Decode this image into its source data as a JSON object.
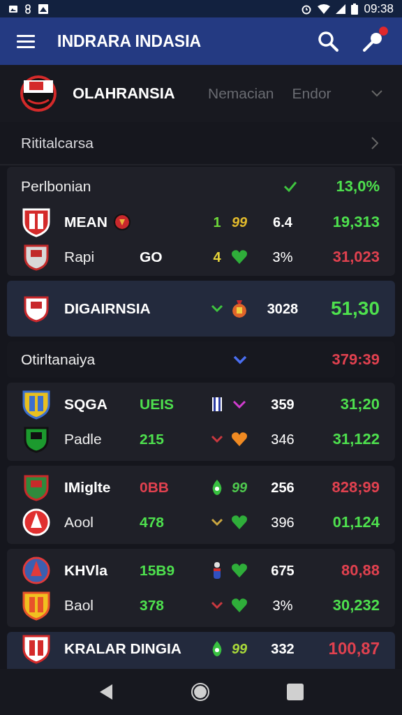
{
  "status_bar": {
    "time": "09:38"
  },
  "app_bar": {
    "title": "INDRARA INDASIA",
    "notification": true
  },
  "league": {
    "name": "OLAHRANSIA",
    "tabs": [
      {
        "label": "Nemacian",
        "selected": false
      },
      {
        "label": "Endor",
        "selected": false
      }
    ]
  },
  "section": {
    "title": "Rititalcarsa"
  },
  "cards": [
    {
      "kind": "group",
      "header": {
        "title": "Perlbonian",
        "marker": {
          "kind": "check",
          "color": "#3fc43f"
        },
        "total": {
          "text": "13,0%",
          "color": "#4ee04e"
        }
      },
      "rows": [
        {
          "name": "MEAN",
          "badge": {
            "kind": "ball"
          },
          "mark": {
            "kind": "score",
            "text": "1",
            "color": "#6ed83a"
          },
          "marker": {
            "kind": "text",
            "text": "99",
            "color": "#e0b92c"
          },
          "value": "6.4",
          "total": {
            "text": "19,313",
            "color": "#4ee04e"
          }
        },
        {
          "name": "Rapi",
          "code": {
            "text": "GO",
            "color": "#ffffff"
          },
          "mark": {
            "kind": "score",
            "text": "4",
            "color": "#e6d43a"
          },
          "marker": {
            "kind": "heart",
            "color": "#2fae3a"
          },
          "value": "3%",
          "total": {
            "text": "31,023",
            "color": "#e0414f"
          }
        }
      ]
    },
    {
      "kind": "featured",
      "rows": [
        {
          "name": "DIGAIRNSIA",
          "mark": {
            "kind": "chevron",
            "color": "#3fc43f"
          },
          "marker": {
            "kind": "medal",
            "color": "#e0642a"
          },
          "value": "3028",
          "total": {
            "text": "51,30",
            "color": "#4ee04e"
          }
        }
      ]
    },
    {
      "kind": "section",
      "header": {
        "title": "Otirltanaiya",
        "marker": {
          "kind": "chevron",
          "color": "#4a6ef0"
        },
        "total": {
          "text": "379:39",
          "color": "#e0414f"
        }
      }
    },
    {
      "kind": "group",
      "rows": [
        {
          "name": "SQGA",
          "code": {
            "text": "UEIS",
            "color": "#4ee04e"
          },
          "mark": {
            "kind": "flag"
          },
          "marker": {
            "kind": "chevron",
            "color": "#d13ccf"
          },
          "value": "359",
          "total": {
            "text": "31;20",
            "color": "#4ee04e"
          }
        },
        {
          "name": "Padle",
          "code": {
            "text": "215",
            "color": "#4ee04e"
          },
          "mark": {
            "kind": "chevron",
            "color": "#c8383f"
          },
          "marker": {
            "kind": "heart",
            "color": "#f08a22"
          },
          "value": "346",
          "total": {
            "text": "31,122",
            "color": "#4ee04e"
          }
        }
      ]
    },
    {
      "kind": "group",
      "rows": [
        {
          "name": "IMiglte",
          "code": {
            "text": "0BB",
            "color": "#e0414f"
          },
          "mark": {
            "kind": "leaf"
          },
          "marker": {
            "kind": "text",
            "text": "99",
            "color": "#4ec84e"
          },
          "value": "256",
          "total": {
            "text": "828;99",
            "color": "#e0414f"
          }
        },
        {
          "name": "Aool",
          "code": {
            "text": "478",
            "color": "#4ee04e"
          },
          "mark": {
            "kind": "chevron",
            "color": "#c9a640"
          },
          "marker": {
            "kind": "heart",
            "color": "#2fae3a"
          },
          "value": "396",
          "total": {
            "text": "01,124",
            "color": "#4ee04e"
          }
        }
      ]
    },
    {
      "kind": "group",
      "rows": [
        {
          "name": "KHVla",
          "code": {
            "text": "15B9",
            "color": "#4ee04e"
          },
          "mark": {
            "kind": "figure"
          },
          "marker": {
            "kind": "heart",
            "color": "#2fae3a"
          },
          "value": "675",
          "total": {
            "text": "80,88",
            "color": "#e0414f"
          }
        },
        {
          "name": "Baol",
          "code": {
            "text": "378",
            "color": "#4ee04e"
          },
          "mark": {
            "kind": "chevron",
            "color": "#c8383f"
          },
          "marker": {
            "kind": "heart",
            "color": "#2fae3a"
          },
          "value": "3%",
          "total": {
            "text": "30,232",
            "color": "#4ee04e"
          }
        }
      ]
    },
    {
      "kind": "partial",
      "rows": [
        {
          "name": "KRALAR DINGIA",
          "mark": {
            "kind": "leaf"
          },
          "marker": {
            "kind": "text",
            "text": "99",
            "color": "#a8d83a"
          },
          "value": "332",
          "total": {
            "text": "100,87",
            "color": "#e0414f"
          }
        }
      ]
    }
  ]
}
